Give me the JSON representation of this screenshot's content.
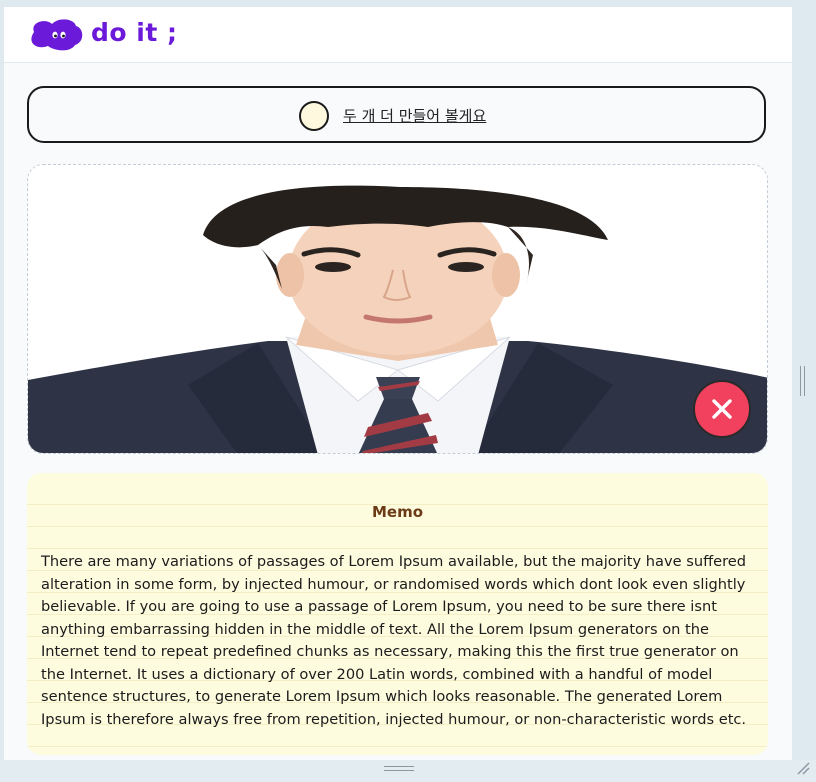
{
  "app": {
    "logo_text": "do it ;",
    "brand_color": "#6a1ad8"
  },
  "todo": {
    "text": "두 개 더 만들어 볼게요",
    "checked": false
  },
  "image": {
    "description_icon": "portrait-photo"
  },
  "delete_button": {
    "icon": "close-icon",
    "color": "#f2405f"
  },
  "memo": {
    "title": "Memo",
    "body": "There are many variations of passages of Lorem Ipsum available, but the majority have suffered alteration in some form, by injected humour, or randomised words which dont look even slightly believable. If you are going to use a passage of Lorem Ipsum, you need to be sure there isnt anything embarrassing hidden in the middle of text. All the Lorem Ipsum generators on the Internet tend to repeat predefined chunks as necessary, making this the first true generator on the Internet. It uses a dictionary of over 200 Latin words, combined with a handful of model sentence structures, to generate Lorem Ipsum which looks reasonable. The generated Lorem Ipsum is therefore always free from repetition, injected humour, or non-characteristic words etc."
  }
}
